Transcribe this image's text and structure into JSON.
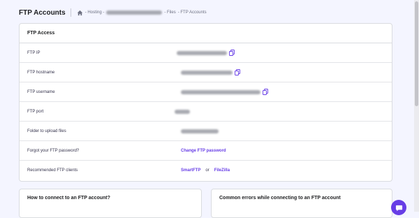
{
  "header": {
    "title": "FTP Accounts",
    "breadcrumb": {
      "home_icon": "home-icon",
      "hosting": "- Hosting -",
      "files": "- Files",
      "ftp_accounts": "- FTP Accounts"
    }
  },
  "ftp_access": {
    "title": "FTP Access",
    "rows": [
      {
        "label": "FTP IP"
      },
      {
        "label": "FTP hostname"
      },
      {
        "label": "FTP username"
      },
      {
        "label": "FTP port"
      },
      {
        "label": "Folder to upload files"
      },
      {
        "label": "Forgot your FTP password?",
        "link": "Change FTP password"
      },
      {
        "label": "Recommended FTP clients",
        "link1": "SmartFTP",
        "or": "or",
        "link2": "FileZilla"
      }
    ]
  },
  "cards": {
    "connect_title": "How to connect to an FTP account?",
    "errors_title": "Common errors while connecting to an FTP account"
  },
  "colors": {
    "accent": "#673de6",
    "background": "#f4f5ff"
  }
}
